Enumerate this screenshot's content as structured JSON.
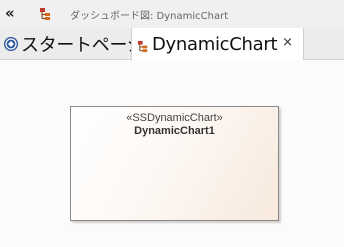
{
  "toolbar": {
    "collapse_glyph": "«",
    "collapse_icon": "double-chevron-left-icon",
    "diagram_icon": "diagram-tree-icon",
    "breadcrumb": "ダッシュボード図: DynamicChart"
  },
  "tabs": [
    {
      "label": "スタートページ",
      "icon": "start-page-icon",
      "active": false
    },
    {
      "label": "DynamicChart",
      "icon": "diagram-tree-icon",
      "active": true,
      "close_glyph": "×"
    }
  ],
  "diagram": {
    "element": {
      "stereotype": "«SSDynamicChart»",
      "name": "DynamicChart1"
    }
  },
  "colors": {
    "accent": "#2b579a",
    "icon_orange": "#d06a1c",
    "icon_red": "#c0392b"
  }
}
